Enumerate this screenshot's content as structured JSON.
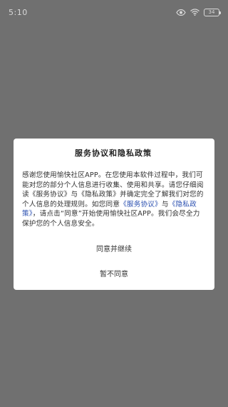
{
  "status_bar": {
    "time": "5:10",
    "battery_level": "34"
  },
  "dialog": {
    "title": "服务协议和隐私政策",
    "body": {
      "p1": "感谢您使用愉快社区APP。在您使用本软件过程中，我们可能对您的部分个人信息进行收集、使用和共享。请您仔细阅读《服务协议》与《隐私政策》并确定完全了解我们对您的个人信息的处理规则。如您同意",
      "link_service": "《服务协议》",
      "and": "与",
      "link_privacy": "《隐私政策》",
      "p2": "，请点击“同意”开始使用愉快社区APP。我们会尽全力保护您的个人信息安全。"
    },
    "agree_label": "同意并继续",
    "disagree_label": "暂不同意"
  }
}
